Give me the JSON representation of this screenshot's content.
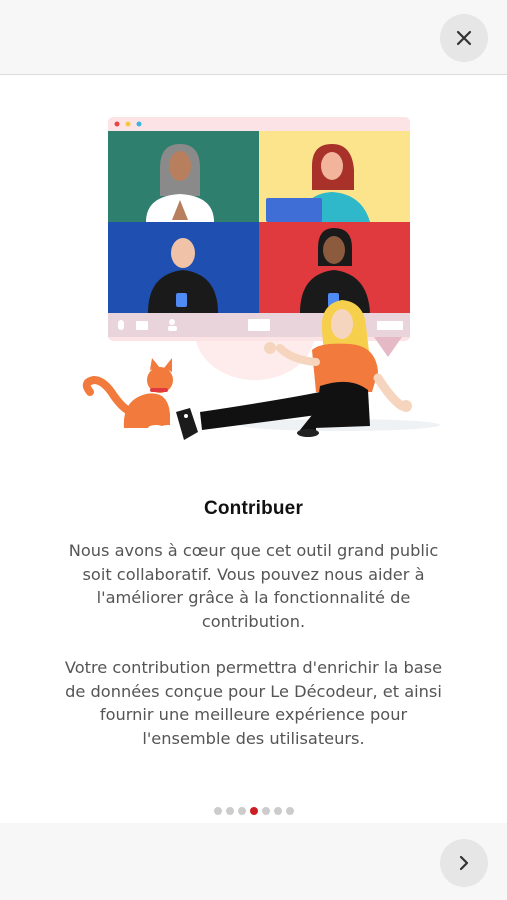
{
  "header": {
    "close_icon": "close-icon"
  },
  "slide": {
    "title": "Contribuer",
    "paragraph1": "Nous avons à cœur que cet outil grand public soit collaboratif. Vous pouvez nous aider à l'améliorer grâce à la fonctionnalité de contribution.",
    "paragraph2": "Votre contribution permettra d'enrichir la base de données conçue pour Le Décodeur, et ainsi fournir une meilleure expérience pour l'ensemble des utilisateurs."
  },
  "pagination": {
    "total": 7,
    "current": 4,
    "active_color": "#cc1f24",
    "inactive_color": "#cccccc"
  },
  "footer": {
    "next_icon": "chevron-right-icon"
  }
}
